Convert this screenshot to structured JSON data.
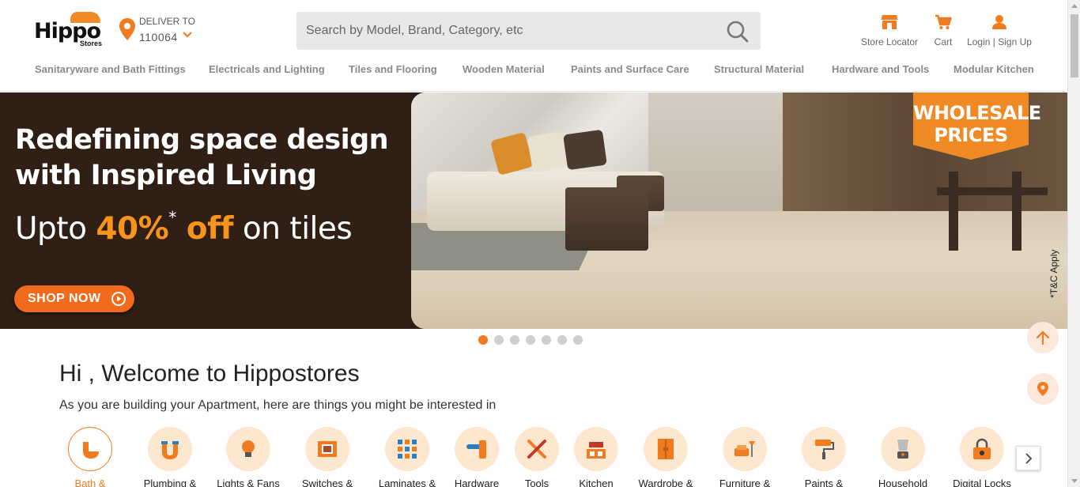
{
  "brand": {
    "logo_text": "Hippo",
    "logo_subtext": "Stores",
    "accent": "#f07c1f"
  },
  "deliver": {
    "label": "DELIVER TO",
    "pincode": "110064",
    "icon": "location-pin-icon"
  },
  "search": {
    "placeholder": "Search by Model, Brand, Category, etc",
    "value": "",
    "icon": "search-icon"
  },
  "header_actions": [
    {
      "label": "Store Locator",
      "icon": "store-icon"
    },
    {
      "label": "Cart",
      "icon": "cart-icon"
    },
    {
      "label": "Login | Sign Up",
      "icon": "user-icon"
    }
  ],
  "nav": [
    "Sanitaryware and Bath Fittings",
    "Electricals and Lighting",
    "Tiles and Flooring",
    "Wooden Material",
    "Paints and Surface Care",
    "Structural Material",
    "Hardware and Tools",
    "Modular Kitchen"
  ],
  "banner": {
    "headline": "Redefining space design with Inspired Living",
    "offer_prefix": "Upto ",
    "offer_percent": "40%",
    "offer_asterisk": "*",
    "offer_off": " off",
    "offer_suffix": " on tiles",
    "cta": "SHOP NOW",
    "tag": "WHOLESALE PRICES",
    "tnc": "*T&C Apply",
    "slide_count": 7,
    "active_slide": 1
  },
  "welcome": {
    "title": "Hi , Welcome to Hippostores",
    "subtitle": "As you are building your Apartment, here are things you might be interested in"
  },
  "categories": [
    {
      "label": "Bath &",
      "icon": "bathtub-icon",
      "active": true
    },
    {
      "label": "Plumbing &",
      "icon": "pipe-icon"
    },
    {
      "label": "Lights & Fans",
      "icon": "bulb-icon"
    },
    {
      "label": "Switches &",
      "icon": "switch-icon"
    },
    {
      "label": "Laminates &",
      "icon": "laminate-icon"
    },
    {
      "label": "Hardware",
      "icon": "door-handle-icon"
    },
    {
      "label": "Tools",
      "icon": "tools-icon"
    },
    {
      "label": "Kitchen",
      "icon": "kitchen-icon"
    },
    {
      "label": "Wardrobe &",
      "icon": "wardrobe-icon"
    },
    {
      "label": "Furniture &",
      "icon": "sofa-icon"
    },
    {
      "label": "Paints &",
      "icon": "paint-roller-icon"
    },
    {
      "label": "Household",
      "icon": "mixer-icon"
    },
    {
      "label": "Digital Locks",
      "icon": "lock-icon"
    }
  ]
}
